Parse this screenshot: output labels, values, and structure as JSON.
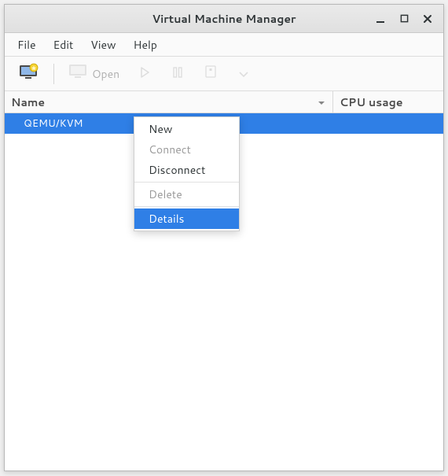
{
  "colors": {
    "selection": "#2f7fe6"
  },
  "titlebar": {
    "title": "Virtual Machine Manager"
  },
  "menubar": {
    "items": [
      "File",
      "Edit",
      "View",
      "Help"
    ]
  },
  "toolbar": {
    "open_label": "Open"
  },
  "columns": {
    "name": "Name",
    "cpu": "CPU usage"
  },
  "connections": [
    {
      "label": "QEMU/KVM",
      "selected": true
    }
  ],
  "context_menu": {
    "items": [
      {
        "label": "New",
        "enabled": true,
        "highlight": false
      },
      {
        "label": "Connect",
        "enabled": false,
        "highlight": false
      },
      {
        "label": "Disconnect",
        "enabled": true,
        "highlight": false
      },
      {
        "separator": true
      },
      {
        "label": "Delete",
        "enabled": false,
        "highlight": false
      },
      {
        "separator": true
      },
      {
        "label": "Details",
        "enabled": true,
        "highlight": true
      }
    ]
  }
}
